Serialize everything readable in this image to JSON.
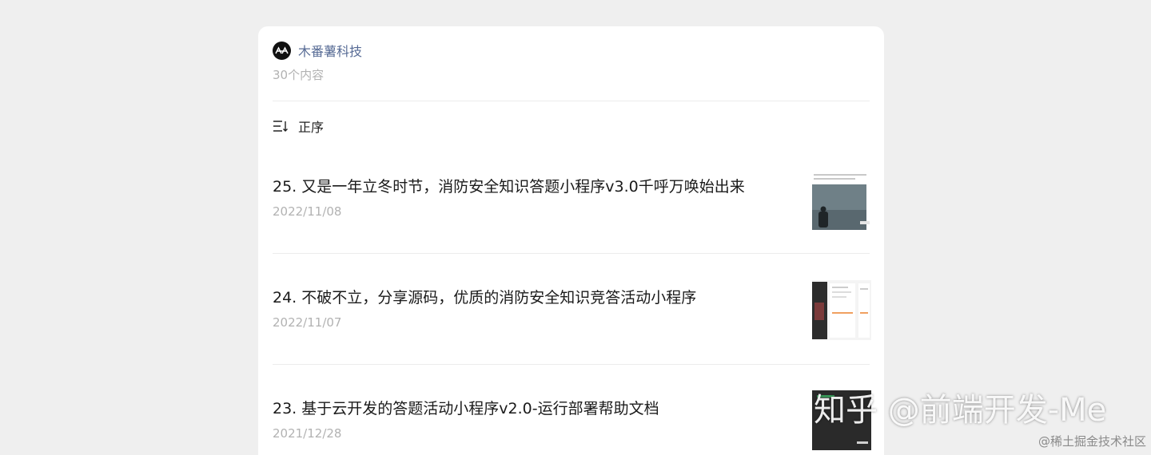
{
  "author": {
    "name": "木番薯科技",
    "count_label": "30个内容"
  },
  "sort": {
    "label": "正序",
    "icon": "sort-icon"
  },
  "articles": [
    {
      "title": "25. 又是一年立冬时节，消防安全知识答题小程序v3.0千呼万唤始出来",
      "date": "2022/11/08"
    },
    {
      "title": "24. 不破不立，分享源码，优质的消防安全知识竞答活动小程序",
      "date": "2022/11/07"
    },
    {
      "title": "23. 基于云开发的答题活动小程序v2.0-运行部署帮助文档",
      "date": "2021/12/28"
    }
  ],
  "watermark": {
    "text": "知乎 @前端开发-Me",
    "source": "@稀土掘金技术社区"
  },
  "colors": {
    "author_link": "#576b95",
    "muted": "#b2b2b2",
    "background": "#efefef"
  }
}
